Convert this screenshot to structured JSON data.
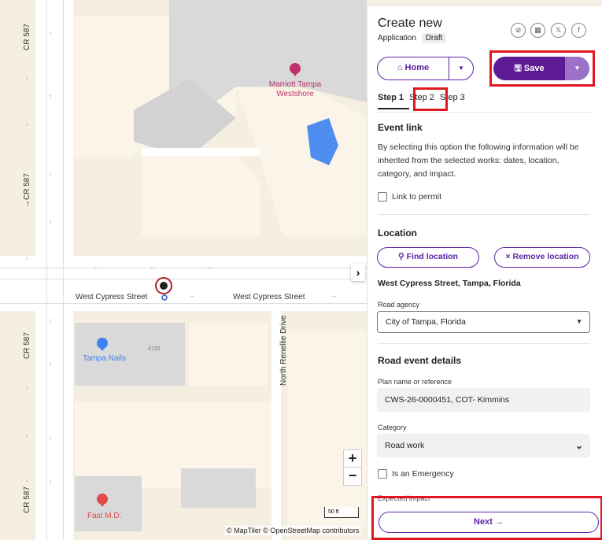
{
  "map": {
    "streets": {
      "cypress_left": "West Cypress Street",
      "cypress_right": "West Cypress Street",
      "cr587_a": "CR 587",
      "cr587_b": "→CR 587",
      "cr587_c": "CR 587",
      "cr587_d": "CR 587",
      "renellie": "North Renellie Drive"
    },
    "pois": {
      "marriott": "Marriott Tampa Westshore",
      "tampa_nails": "Tampa Nails",
      "building_number": "4720",
      "fast_md": "Fast M.D."
    },
    "zoom_in": "+",
    "zoom_out": "−",
    "collapse": "›",
    "scale": "50 ft",
    "attribution": "© MapTiler © OpenStreetMap contributors",
    "colors": {
      "marriott": "#c0306a",
      "nails": "#3b82f6",
      "fastmd": "#e14a4a",
      "water": "#4f8df0"
    }
  },
  "panel": {
    "title": "Create new",
    "subtitle": "Application",
    "badge": "Draft",
    "share_icons": [
      "link-icon",
      "qr-icon",
      "x-icon",
      "facebook-icon"
    ],
    "share_glyphs": [
      "⊘",
      "▦",
      "𝕏",
      "f"
    ],
    "home": {
      "icon": "home-icon",
      "label": "⌂ Home",
      "caret": "▼"
    },
    "save": {
      "icon": "save-icon",
      "label": "🖫 Save",
      "caret": "▼"
    },
    "steps": [
      "Step 1",
      "Step 2",
      "Step 3"
    ],
    "event_link": {
      "heading": "Event link",
      "description": "By selecting this option the following information will be inherited from the selected works: dates, location, category, and impact.",
      "checkbox": "Link to permit"
    },
    "location": {
      "heading": "Location",
      "find_button": "⚲ Find location",
      "remove_button": "× Remove location",
      "address": "West Cypress Street, Tampa, Florida",
      "agency_label": "Road agency",
      "agency_value": "City of Tampa, Florida",
      "caret": "▼"
    },
    "road_event": {
      "heading": "Road event details",
      "plan_label": "Plan name or reference",
      "plan_value": "CWS-26-0000451, COT- Kimmins",
      "category_label": "Category",
      "category_value": "Road work",
      "caret": "⌄",
      "emergency_checkbox": "Is an Emergency",
      "cut_label": "Expected impact"
    },
    "next_button": "Next →",
    "accent": "#5b22a6",
    "highlight": "#e0151f"
  }
}
